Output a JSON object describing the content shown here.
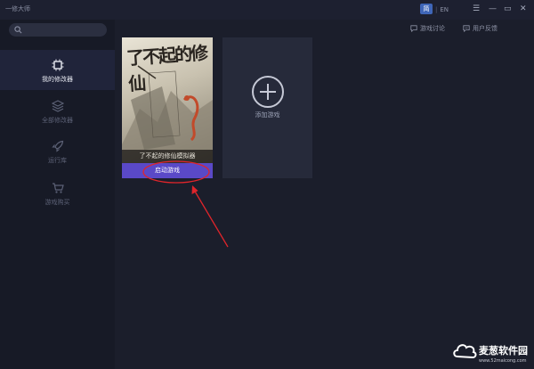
{
  "app": {
    "title": "一修大师"
  },
  "lang": {
    "zh": "简",
    "en": "EN"
  },
  "window": {
    "menu": "☰",
    "minimize": "—",
    "maximize": "▭",
    "close": "✕"
  },
  "sidebar": {
    "search_placeholder": "",
    "items": [
      {
        "label": "我的修改器",
        "icon": "chip-icon",
        "active": true
      },
      {
        "label": "全部修改器",
        "icon": "layers-icon",
        "active": false
      },
      {
        "label": "运行库",
        "icon": "rocket-icon",
        "active": false
      },
      {
        "label": "游戏购买",
        "icon": "cart-icon",
        "active": false
      }
    ]
  },
  "header": {
    "discuss": "游戏讨论",
    "feedback": "用户反馈"
  },
  "game": {
    "poster_title": "了不起的修仙",
    "poster_caption": "了不起的修仙模拟器",
    "launch": "启动游戏"
  },
  "add_game": {
    "label": "添加游戏"
  },
  "watermark": {
    "brand": "麦葱软件园",
    "url": "www.52maicong.com"
  },
  "colors": {
    "accent": "#5a49c7",
    "annotation": "#e0252b"
  }
}
